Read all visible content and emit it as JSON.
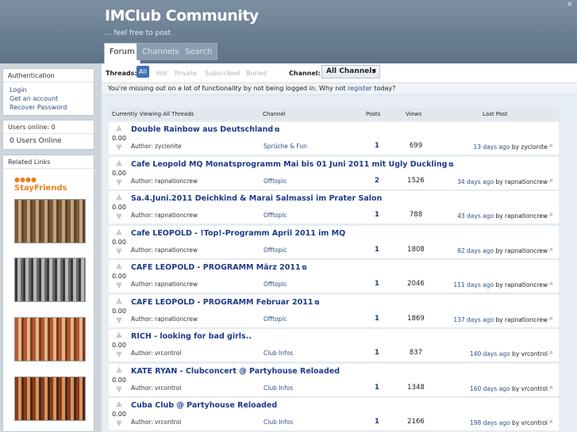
{
  "header": {
    "title": "IMClub Community",
    "tagline": "... feel free to post",
    "tabs": [
      {
        "label": "Forum",
        "active": true
      },
      {
        "label": "Channels",
        "active": false
      },
      {
        "label": "Search",
        "active": false
      }
    ]
  },
  "sidebar": {
    "auth": {
      "title": "Authentication",
      "links": [
        "Login",
        "Get an account",
        "Recover Password"
      ]
    },
    "users": {
      "title": "Users online: 0",
      "text": "0 Users Online"
    },
    "related": {
      "title": "Related Links",
      "logo": "StayFriends"
    }
  },
  "filters": {
    "threads_label": "Threads:",
    "options": [
      "All",
      "Hot",
      "Private",
      "Subscribed",
      "Buried"
    ],
    "channel_label": "Channel:",
    "channel_value": "All Channels"
  },
  "notice": {
    "text_before": "You're missing out on a lot of functionality by not being logged in. Why not ",
    "link": "register",
    "text_after": " today?"
  },
  "table": {
    "headers": [
      "Currently Viewing All Threads",
      "Channel",
      "Posts",
      "Views",
      "Last Post"
    ],
    "rows": [
      {
        "score": "0.00",
        "title": "Double Rainbow aus Deutschland",
        "ext": true,
        "author": "Author: zyclonite",
        "channel": "Sprüche & Fun",
        "posts": "1",
        "views": "699",
        "when": "13 days ago",
        "by": " by zyclonite"
      },
      {
        "score": "0.00",
        "title": "Cafe Leopold MQ Monatsprogramm Mai bis 01 Juni 2011 mit Ugly Duckling",
        "ext": true,
        "author": "Author: rapnationcrew",
        "channel": "Offtopic",
        "posts": "2",
        "views": "1526",
        "when": "34 days ago",
        "by": " by rapnationcrew"
      },
      {
        "score": "0.00",
        "title": "Sa.4.Juni.2011 Deichkind & Marai Salmassi im Prater Salon",
        "ext": false,
        "author": "Author: rapnationcrew",
        "channel": "Offtopic",
        "posts": "1",
        "views": "788",
        "when": "43 days ago",
        "by": " by rapnationcrew"
      },
      {
        "score": "0.00",
        "title": "Cafe LEOPOLD - !Top!-Programm April 2011 im MQ",
        "ext": false,
        "author": "Author: rapnationcrew",
        "channel": "Offtopic",
        "posts": "1",
        "views": "1808",
        "when": "82 days ago",
        "by": " by rapnationcrew"
      },
      {
        "score": "0.00",
        "title": "CAFE LEOPOLD - PROGRAMM März 2011",
        "ext": true,
        "author": "Author: rapnationcrew",
        "channel": "Offtopic",
        "posts": "1",
        "views": "2046",
        "when": "111 days ago",
        "by": " by rapnationcrew"
      },
      {
        "score": "0.00",
        "title": "CAFE LEOPOLD - PROGRAMM Februar 2011",
        "ext": true,
        "author": "Author: rapnationcrew",
        "channel": "Offtopic",
        "posts": "1",
        "views": "1869",
        "when": "137 days ago",
        "by": " by rapnationcrew"
      },
      {
        "score": "0.00",
        "title": "RICH - looking for bad girls..",
        "ext": false,
        "author": "Author: vrcontrol",
        "channel": "Club Infos",
        "posts": "1",
        "views": "837",
        "when": "140 days ago",
        "by": " by vrcontrol"
      },
      {
        "score": "0.00",
        "title": "KATE RYAN - Clubconcert @ Partyhouse Reloaded",
        "ext": false,
        "author": "Author: vrcontrol",
        "channel": "Club Infos",
        "posts": "1",
        "views": "1348",
        "when": "160 days ago",
        "by": " by vrcontrol"
      },
      {
        "score": "0.00",
        "title": "Cuba Club @ Partyhouse Reloaded",
        "ext": false,
        "author": "Author: vrcontrol",
        "channel": "Club Infos",
        "posts": "1",
        "views": "2166",
        "when": "198 days ago",
        "by": " by vrcontrol"
      }
    ]
  },
  "icons": {
    "vote_up": "arrow-up-icon",
    "vote_down": "arrow-down-icon",
    "external": "external-link-icon",
    "last_post": "view-last-post-icon"
  },
  "colors": {
    "header_bg": "#6c8196",
    "link": "#1d3a8a",
    "active_filter": "#3f6fb3",
    "page_bg": "#cdd6dd"
  }
}
